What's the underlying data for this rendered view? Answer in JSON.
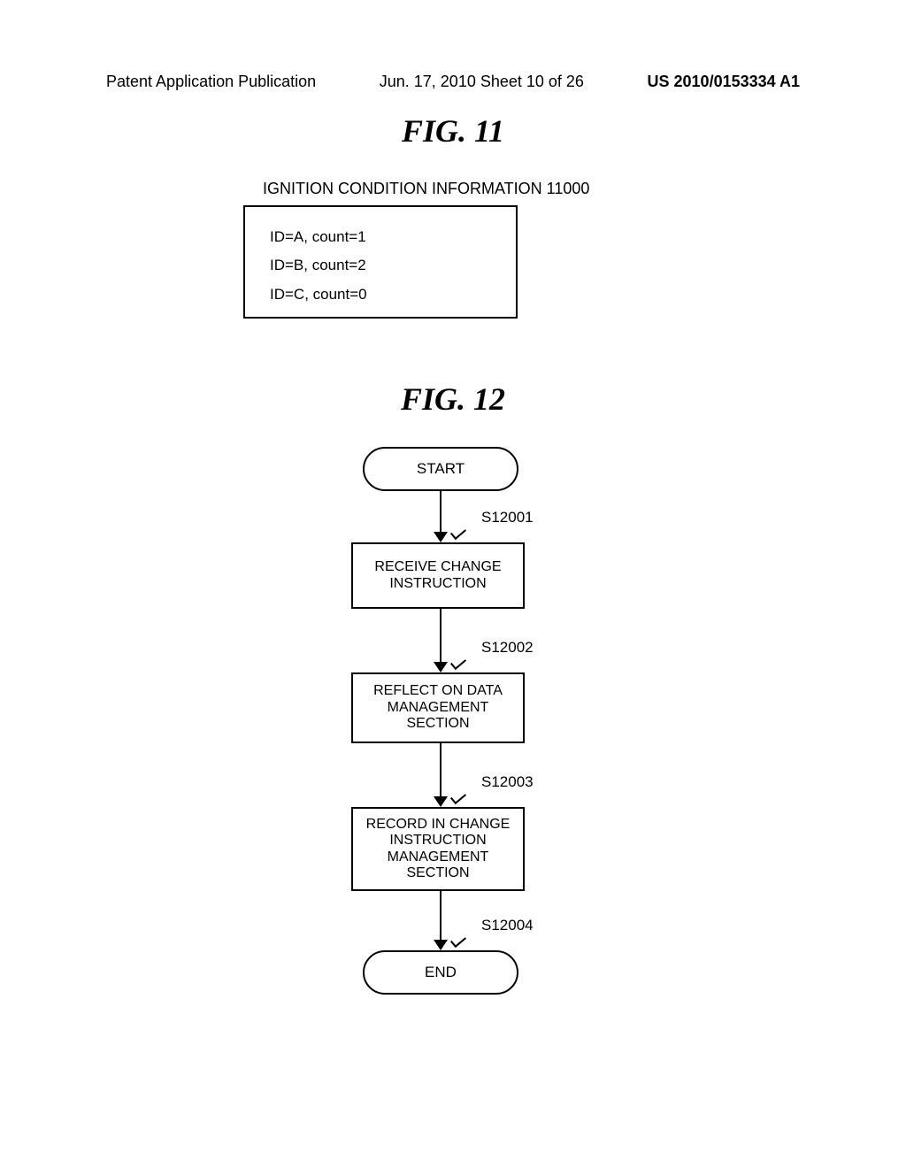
{
  "header": {
    "left": "Patent Application Publication",
    "center": "Jun. 17, 2010  Sheet 10 of 26",
    "right": "US 2010/0153334 A1"
  },
  "fig11": {
    "title": "FIG. 11",
    "caption": "IGNITION CONDITION INFORMATION 11000",
    "rows": [
      "ID=A, count=1",
      "ID=B, count=2",
      "ID=C, count=0"
    ]
  },
  "fig12": {
    "title": "FIG. 12",
    "start": "START",
    "end": "END",
    "steps": [
      {
        "label": "S12001",
        "text": "RECEIVE CHANGE INSTRUCTION"
      },
      {
        "label": "S12002",
        "text": "REFLECT ON DATA MANAGEMENT SECTION"
      },
      {
        "label": "S12003",
        "text": "RECORD IN CHANGE INSTRUCTION MANAGEMENT SECTION"
      },
      {
        "label": "S12004",
        "text": ""
      }
    ]
  }
}
